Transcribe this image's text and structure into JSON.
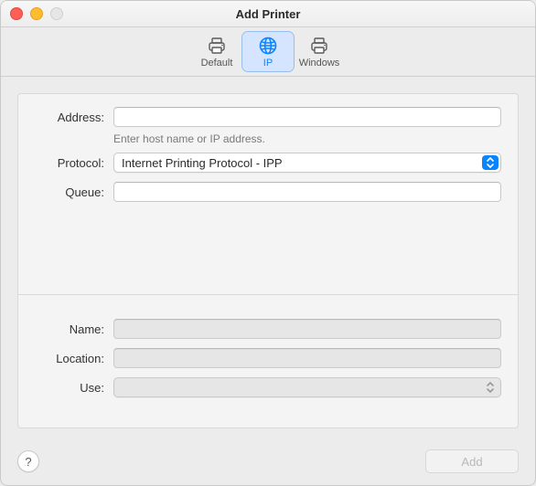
{
  "window": {
    "title": "Add Printer"
  },
  "toolbar": {
    "default_label": "Default",
    "ip_label": "IP",
    "windows_label": "Windows",
    "selected": "ip"
  },
  "form": {
    "address_label": "Address:",
    "address_value": "",
    "address_hint": "Enter host name or IP address.",
    "protocol_label": "Protocol:",
    "protocol_value": "Internet Printing Protocol - IPP",
    "queue_label": "Queue:",
    "queue_value": "",
    "name_label": "Name:",
    "name_value": "",
    "location_label": "Location:",
    "location_value": "",
    "use_label": "Use:",
    "use_value": ""
  },
  "buttons": {
    "add_label": "Add",
    "help_label": "?"
  },
  "icons": {
    "printer": "printer-icon",
    "globe": "globe-icon",
    "win_printer": "windows-printer-icon"
  }
}
